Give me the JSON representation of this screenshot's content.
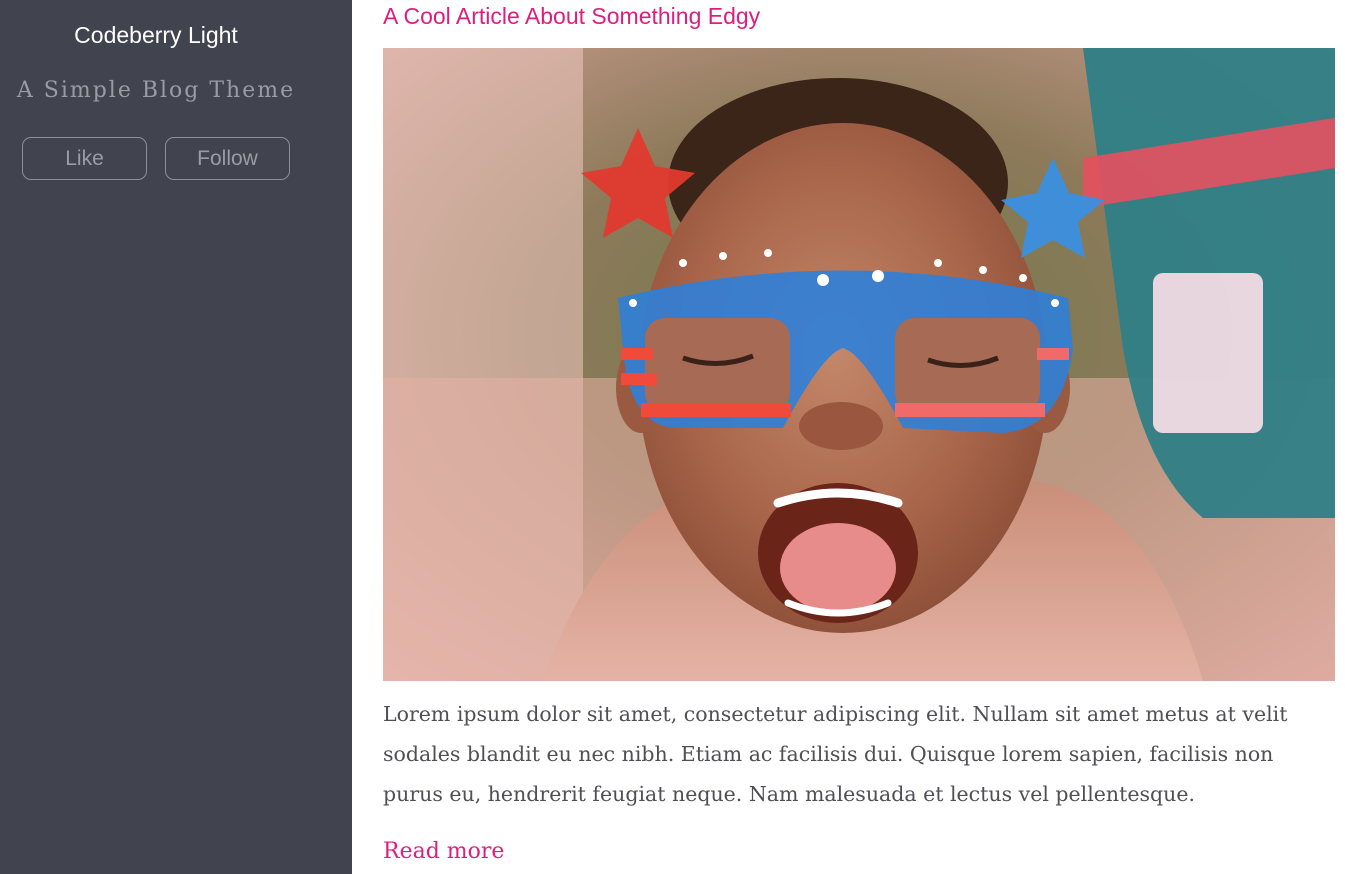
{
  "sidebar": {
    "site_title": "Codeberry Light",
    "tagline": "A Simple Blog Theme",
    "like_label": "Like",
    "follow_label": "Follow"
  },
  "post": {
    "title": "A Cool Article About Something Edgy",
    "excerpt": "Lorem ipsum dolor sit amet, consectetur adipiscing elit. Nullam sit amet metus at velit sodales blandit eu nec nibh. Etiam ac facilisis dui. Quisque lorem sapien, facilisis non purus eu, hendrerit feugiat neque. Nam malesuada et lectus vel pellentesque.",
    "read_more_label": "Read more"
  },
  "colors": {
    "sidebar_bg": "#41444e",
    "accent": "#de1e7e",
    "body_text": "#4f4f55",
    "muted_text": "#9a9ca4"
  }
}
